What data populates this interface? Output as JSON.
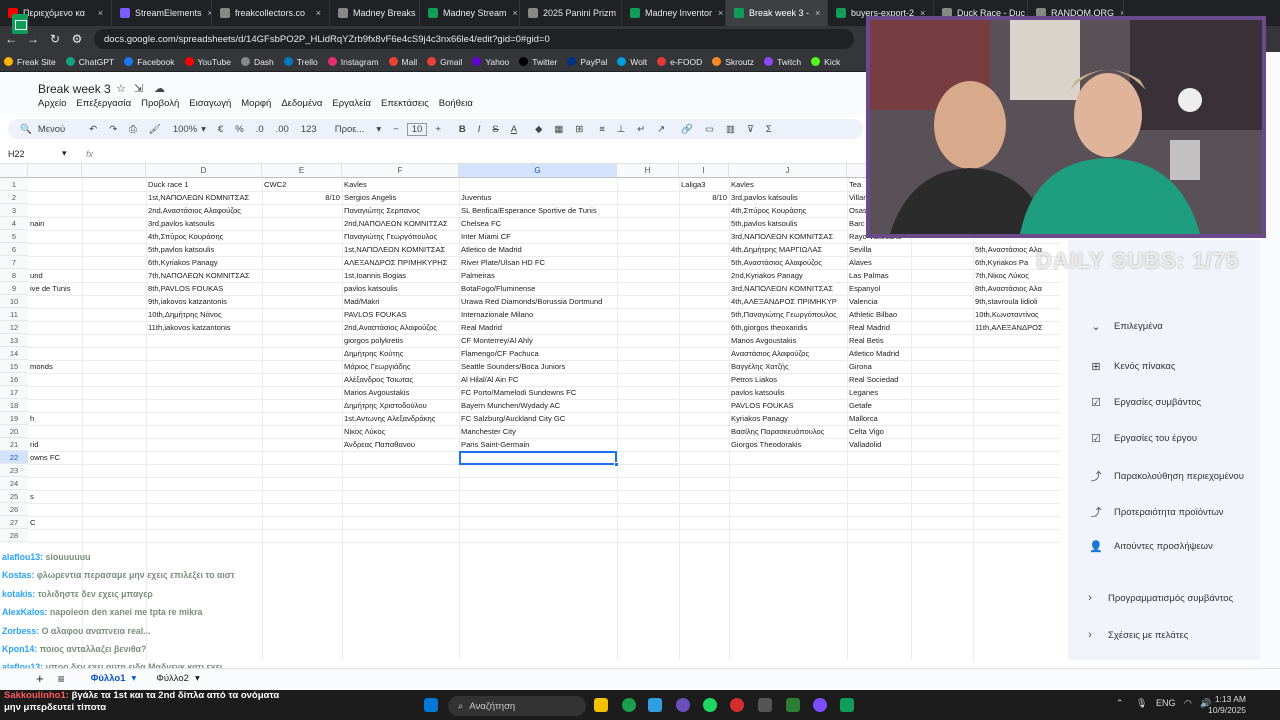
{
  "browser": {
    "tabs": [
      {
        "label": "Περιεχόμενο κα",
        "color": "#ff0000"
      },
      {
        "label": "StreamElements",
        "color": "#7b5cff"
      },
      {
        "label": "freakcollectors.co",
        "color": "#888888"
      },
      {
        "label": "Madney Breaks",
        "color": "#888888"
      },
      {
        "label": "Madney Stream",
        "color": "#0f9d58"
      },
      {
        "label": "2025 Panini Prizm",
        "color": "#888888"
      },
      {
        "label": "Madney Inventor",
        "color": "#0f9d58"
      },
      {
        "label": "Break week 3 -",
        "color": "#0f9d58"
      },
      {
        "label": "buyers-export-2",
        "color": "#0f9d58"
      },
      {
        "label": "Duck Race - Duc",
        "color": "#888888"
      },
      {
        "label": "RANDOM.ORG",
        "color": "#888888"
      }
    ],
    "url": "docs.google.com/spreadsheets/d/14GFsbPO2P_HLidRqYZrb9fx8vF6e4cS9j4c3nx66le4/edit?gid=0#gid=0",
    "bookmarks": [
      {
        "label": "Freak Site",
        "color": "#ffb300"
      },
      {
        "label": "ChatGPT",
        "color": "#10a37f"
      },
      {
        "label": "Facebook",
        "color": "#1877f2"
      },
      {
        "label": "YouTube",
        "color": "#ff0000"
      },
      {
        "label": "Dash",
        "color": "#888888"
      },
      {
        "label": "Trello",
        "color": "#0079bf"
      },
      {
        "label": "Instagram",
        "color": "#e1306c"
      },
      {
        "label": "Mail",
        "color": "#ea4335"
      },
      {
        "label": "Gmail",
        "color": "#ea4335"
      },
      {
        "label": "Yahoo",
        "color": "#6001d2"
      },
      {
        "label": "Twitter",
        "color": "#000000"
      },
      {
        "label": "PayPal",
        "color": "#003087"
      },
      {
        "label": "Wolt",
        "color": "#009de0"
      },
      {
        "label": "e-FOOD",
        "color": "#e53935"
      },
      {
        "label": "Skroutz",
        "color": "#f68b24"
      },
      {
        "label": "Twitch",
        "color": "#9146ff"
      },
      {
        "label": "Kick",
        "color": "#53fc18"
      }
    ]
  },
  "sheets": {
    "title": "Break week 3",
    "menu": [
      "Αρχείο",
      "Επεξεργασία",
      "Προβολή",
      "Εισαγωγή",
      "Μορφή",
      "Δεδομένα",
      "Εργαλεία",
      "Επεκτάσεις",
      "Βοήθεια"
    ],
    "toolbar": {
      "search": "Μενού",
      "zoom": "100%",
      "currency": "€",
      "percent": "%",
      "dec_less": ".0",
      "dec_more": ".00",
      "number_fmt": "123",
      "font": "Προε...",
      "font_size": "10"
    },
    "name_box": "H22",
    "fx": "fx",
    "columns": [
      "",
      "D",
      "E",
      "F",
      "G",
      "H",
      "I",
      "J",
      "K",
      "Tea"
    ],
    "rows": [
      "1",
      "2",
      "3",
      "4",
      "5",
      "6",
      "7",
      "8",
      "9",
      "10",
      "11",
      "12",
      "13",
      "14",
      "15",
      "16",
      "17",
      "18",
      "19",
      "20",
      "21",
      "22",
      "23",
      "24",
      "25",
      "26",
      "27",
      "28"
    ],
    "colC": {
      "r4": "nain",
      "r8": "und",
      "r9": "ive de Tunis",
      "r15": "monds",
      "r19": "h",
      "r21": "rid",
      "r22": "owns FC",
      "r25": "s",
      "r27": "C"
    },
    "colE": [
      "Duck race 1",
      "1st,ΝΑΠΟΛΕΩΝ ΚΟΜΝΙΤΣΑΣ",
      "2nd,Αναστάσιος Αλαφούζος",
      "3rd,pavlos katsoulis",
      "4th,Σπύρος Κουράσης",
      "5th,pavlos katsoulis",
      "6th,Kyriakos Panagy",
      "7th,ΝΑΠΟΛΕΩΝ ΚΟΜΝΙΤΣΑΣ",
      "8th,PAVLOS FOUKAS",
      "9th,iakovos katzantonis",
      "10th,Δημήτρης Νάνος",
      "11th,iakovos katzantonis"
    ],
    "colF": {
      "r1": "CWC2",
      "r2": "8/10"
    },
    "colG": [
      "Kavles",
      "Sergios Angelis",
      "Παναγιώτης Σερπανος",
      "2nd,ΝΑΠΟΛΕΩΝ ΚΟΜΝΙΤΣΑΣ",
      "Παναγιώτης Γεωργόπουλος",
      "1st,ΝΑΠΟΛΕΩΝ ΚΟΜΝΙΤΣΑΣ",
      "ΑΛΕΞΑΝΔΡΟΣ ΠΡΙΜΗΚΥΡΗΣ",
      "1st,Ioannis Bogias",
      "pavlos katsoulis",
      "Mad/Makri",
      "PAVLOS FOUKAS",
      "2nd,Αναστάσιος Αλαφούζος",
      "giorgos polykretis",
      "Δημήτρης Κούτης",
      "Μάριος Γεωργιάδης",
      "Αλέξανδρος Τσιωτας",
      "Marios Avgoustakis",
      "Δημήτρης Χριστοδούλου",
      "1st,Αντωνης Αλεξανδράκης",
      "Νίκος Λύκος",
      "Άνδρεας Παπαθανου"
    ],
    "colH": [
      "",
      "Juventus",
      "SL Benfica/Esperance Sportive de Tunis",
      "Chelsea FC",
      "Inter Miami CF",
      "Atletico de Madrid",
      "River Plate/Ulsan HD FC",
      "Palmeiras",
      "BotaFogo/Fluminense",
      "Urawa Red Diamonds/Borussia Dortmund",
      "Internazionale Milano",
      "Real Madrid",
      "CF Monterrey/Al Ahly",
      "Flamengo/CF Pachuca",
      "Seattle Sounders/Boca Juniors",
      "Al Hilal/Al Ain FC",
      "FC Porto/Mamelodi Sundowns FC",
      "Bayern Munchen/Wydady AC",
      "FC Salzburg/Auckland City GC",
      "Manchester City",
      "Paris Saint-Germain"
    ],
    "colJ": {
      "r1": "Laliga3",
      "r2": "8/10"
    },
    "colK": [
      "Kavles",
      "3rd,pavlos katsoulis",
      "4th,Σπύρος Κουράσης",
      "5th,pavlos katsoulis",
      "3rd,ΝΑΠΟΛΕΩΝ ΚΟΜΝΙΤΣΑΣ",
      "4th,Δημήτρης ΜΑΡΓΙΩΛΑΣ",
      "5th,Αναστάσιος Αλαφούζος",
      "2nd,Kyriakos Panagy",
      "3rd,ΝΑΠΟΛΕΩΝ ΚΟΜΝΙΤΣΑΣ",
      "4th,ΑΛΕΞΑΝΔΡΟΣ ΠΡΙΜΗΚΥΡ",
      "5th,Παναγιώτης Γεωργόπουλος",
      "6th,giorgos theoxaridis",
      "Manos Avgoustakis",
      "Αναστάσιος Αλαφούζος",
      "Βαγγέλης Χατζής",
      "Petros Liakos",
      "pavlos katsoulis",
      "PAVLOS FOUKAS",
      "Kyriakos Panagy",
      "Βασίλης Παρασκευόπουλος",
      "Giorgos Theodorakis"
    ],
    "colL": [
      "Tea",
      "Villar",
      "Osas",
      "Barc",
      "Rayo Vallecano",
      "Sevilla",
      "Alaves",
      "Las Palmas",
      "Espanyol",
      "Valencia",
      "Athletic Bilbao",
      "Real Madrid",
      "Real Betis",
      "Atletico Madrid",
      "Girona",
      "Real Sociedad",
      "Leganes",
      "Getafe",
      "Mallorca",
      "Celta Vigo",
      "Valladolid"
    ],
    "colN": {
      "r6": "5th,Αναστάσιος Αλα",
      "r7": "6th,Kyriakos Pa",
      "r8": "7th,Νίκος Λύκος",
      "r9": "8th,Αναστάσιος Αλα",
      "r10": "9th,stavroula lidioli",
      "r11": "10th,Κωνσταντίνος",
      "r12": "11th,ΑΛΕΞΑΝΔΡΟΣ"
    },
    "side_panel": {
      "section": "Επιλεγμένα",
      "items": [
        "Κενός πίνακας",
        "Εργασίες συμβάντος",
        "Εργασίες του έργου",
        "Παρακολούθηση περιεχομένου",
        "Προτεραιότητα προϊόντων",
        "Αιτούντες προσλήψεων"
      ],
      "collapsed": [
        "Προγραμματισμός συμβάντος",
        "Σχέσεις με πελάτες"
      ]
    },
    "sheet_tabs": [
      "Φύλλο1",
      "Φύλλο2"
    ]
  },
  "stream": {
    "subs_text": "DAILY SUBS: 1/75",
    "chat": [
      {
        "user": "alaflou13:",
        "msg": "siouuuuuu"
      },
      {
        "user": "Kostas:",
        "msg": "φλωρεντια περασαμε μην εχεις επιλεξει το αιστ"
      },
      {
        "user": "kotakis:",
        "msg": "τολιδηστε δεν εχεις μπαγερ"
      },
      {
        "user": "AlexKalos:",
        "msg": "napoleon den xanei me tpta re mikra"
      },
      {
        "user": "Zorbess:",
        "msg": "Ο αλαφου αναπνεια real..."
      },
      {
        "user": "Kpon14:",
        "msg": "ποιος ανταλλαζει βενιθα?"
      },
      {
        "user": "alaflou13:",
        "msg": "μπρο δεν εχει αυτη ειδα Μαδνεγκ κατι εχει"
      }
    ],
    "overlay_user": "Sakkoulinho1:",
    "overlay_msg_1": "βγάλε τα 1st και τα 2nd δίπλα από τα ονόματα",
    "overlay_msg_2": "μην μπερδευτεί τίποτα"
  },
  "taskbar": {
    "search": "Αναζήτηση",
    "lang": "ENG",
    "time": "1:13 AM",
    "date": "10/9/2025"
  }
}
